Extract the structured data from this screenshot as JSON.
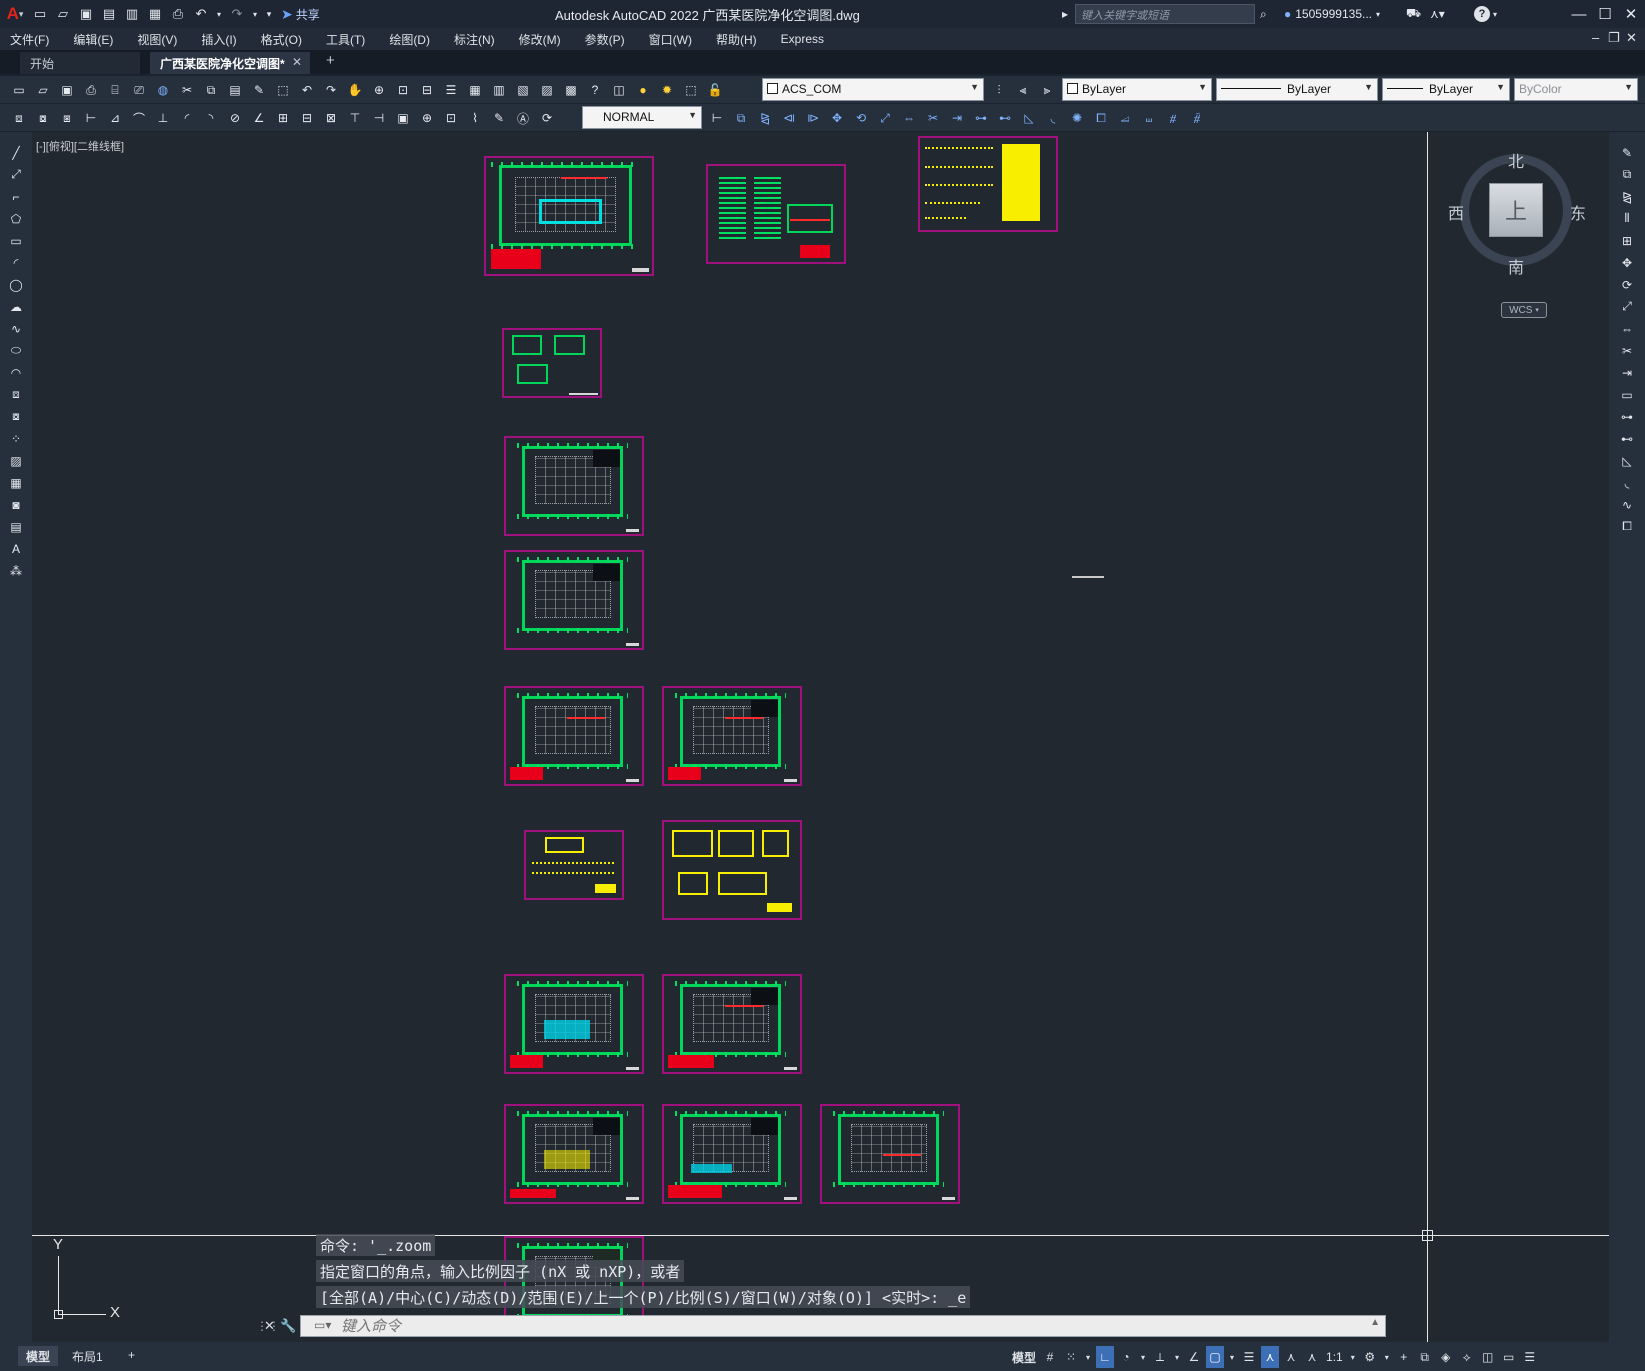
{
  "app": {
    "title": "Autodesk AutoCAD 2022    广西某医院净化空调图.dwg",
    "logo": "A",
    "share_label": "共享",
    "search_placeholder": "键入关键字或短语",
    "user": "1505999135...",
    "help": "?"
  },
  "menu": [
    "文件(F)",
    "编辑(E)",
    "视图(V)",
    "插入(I)",
    "格式(O)",
    "工具(T)",
    "绘图(D)",
    "标注(N)",
    "修改(M)",
    "参数(P)",
    "窗口(W)",
    "帮助(H)",
    "Express"
  ],
  "tabs": {
    "start": "开始",
    "active": "广西某医院净化空调图*",
    "close": "✕",
    "add": "+"
  },
  "properties": {
    "layer": "ACS_COM",
    "color": "ByLayer",
    "linetype": "ByLayer",
    "lineweight": "ByLayer",
    "plotstyle": "ByColor",
    "textstyle": "NORMAL"
  },
  "viewport": {
    "label": "[-][俯视][二维线框]"
  },
  "viewcube": {
    "north": "北",
    "south": "南",
    "east": "东",
    "west": "西",
    "face": "上",
    "wcs": "WCS"
  },
  "ucs": {
    "x": "X",
    "y": "Y"
  },
  "command": {
    "history": [
      "命令: '_.zoom",
      "指定窗口的角点，输入比例因子 (nX 或 nXP)，或者",
      "[全部(A)/中心(C)/动态(D)/范围(E)/上一个(P)/比例(S)/窗口(W)/对象(O)] <实时>: _e"
    ],
    "placeholder": "键入命令"
  },
  "status": {
    "model_tab": "模型",
    "layout_tab": "布局1",
    "add": "+",
    "model_button": "模型",
    "scale": "1:1"
  },
  "colors": {
    "accent": "#3d6fb6",
    "sheet_border": "#a0107e",
    "plan_green": "#00d65a",
    "annotation_yellow": "#f7ee00",
    "title_red": "#e8001a"
  }
}
